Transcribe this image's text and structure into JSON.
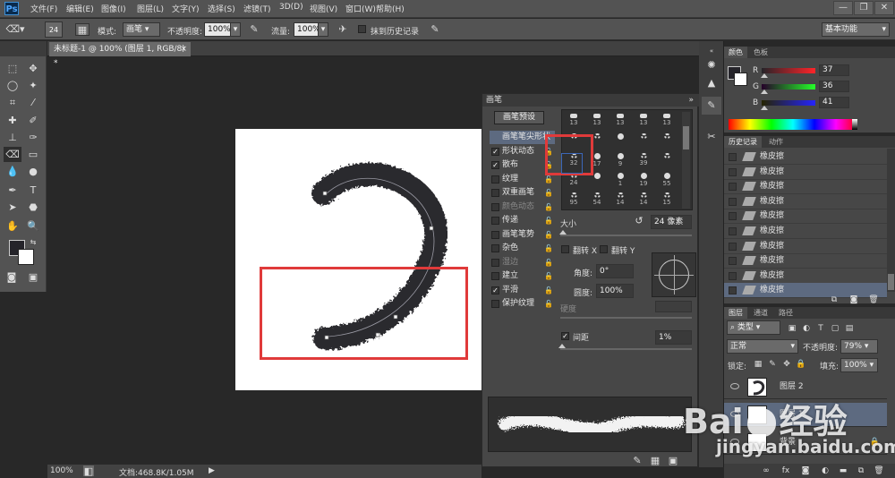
{
  "menubar": {
    "logo": "Ps",
    "items": [
      "文件(F)",
      "编辑(E)",
      "图像(I)",
      "图层(L)",
      "文字(Y)",
      "选择(S)",
      "滤镜(T)",
      "3D(D)",
      "视图(V)",
      "窗口(W)",
      "帮助(H)"
    ],
    "window_controls": [
      "—",
      "❐",
      "✕"
    ]
  },
  "options": {
    "brush_size": "24",
    "mode_label": "模式:",
    "mode_value": "画笔",
    "opacity_label": "不透明度:",
    "opacity_value": "100%",
    "flow_label": "流量:",
    "flow_value": "100%",
    "erase_history_label": "抹到历史记录",
    "workspace": "基本功能"
  },
  "document": {
    "tab_title": "未标题-1 @ 100% (图层 1, RGB/8) *",
    "close": "×"
  },
  "status": {
    "zoom": "100%",
    "doc_info": "文档:468.8K/1.05M"
  },
  "brush_panel": {
    "title": "画笔",
    "preset_button": "画笔预设",
    "sections": [
      {
        "label": "画笔笔尖形状",
        "checkbox": false,
        "checked": false,
        "selected": true,
        "dim": false,
        "lock": false
      },
      {
        "label": "形状动态",
        "checkbox": true,
        "checked": true,
        "selected": false,
        "dim": false,
        "lock": true
      },
      {
        "label": "散布",
        "checkbox": true,
        "checked": true,
        "selected": false,
        "dim": false,
        "lock": true
      },
      {
        "label": "纹理",
        "checkbox": true,
        "checked": false,
        "selected": false,
        "dim": false,
        "lock": true
      },
      {
        "label": "双重画笔",
        "checkbox": true,
        "checked": false,
        "selected": false,
        "dim": false,
        "lock": true
      },
      {
        "label": "颜色动态",
        "checkbox": true,
        "checked": false,
        "selected": false,
        "dim": true,
        "lock": true
      },
      {
        "label": "传递",
        "checkbox": true,
        "checked": false,
        "selected": false,
        "dim": false,
        "lock": true
      },
      {
        "label": "画笔笔势",
        "checkbox": true,
        "checked": false,
        "selected": false,
        "dim": false,
        "lock": true
      },
      {
        "label": "杂色",
        "checkbox": true,
        "checked": false,
        "selected": false,
        "dim": false,
        "lock": true
      },
      {
        "label": "湿边",
        "checkbox": true,
        "checked": false,
        "selected": false,
        "dim": true,
        "lock": true
      },
      {
        "label": "建立",
        "checkbox": true,
        "checked": false,
        "selected": false,
        "dim": false,
        "lock": true
      },
      {
        "label": "平滑",
        "checkbox": true,
        "checked": true,
        "selected": false,
        "dim": false,
        "lock": true
      },
      {
        "label": "保护纹理",
        "checkbox": true,
        "checked": false,
        "selected": false,
        "dim": false,
        "lock": true
      }
    ],
    "tips": [
      {
        "n": "13",
        "s": "bar"
      },
      {
        "n": "13",
        "s": "bar"
      },
      {
        "n": "13",
        "s": "bar"
      },
      {
        "n": "13",
        "s": "bar"
      },
      {
        "n": "13",
        "s": "bar"
      },
      {
        "n": "",
        "s": "splat"
      },
      {
        "n": "",
        "s": "splat"
      },
      {
        "n": "",
        "s": "round"
      },
      {
        "n": "",
        "s": "splat"
      },
      {
        "n": "",
        "s": "splat"
      },
      {
        "n": "32",
        "s": "splat"
      },
      {
        "n": "17",
        "s": "round"
      },
      {
        "n": "9",
        "s": "round"
      },
      {
        "n": "39",
        "s": "splat"
      },
      {
        "n": "",
        "s": "splat"
      },
      {
        "n": "24",
        "s": "splat"
      },
      {
        "n": "",
        "s": "round"
      },
      {
        "n": "1",
        "s": "round"
      },
      {
        "n": "19",
        "s": "round"
      },
      {
        "n": "55",
        "s": "round"
      },
      {
        "n": "95",
        "s": "splat"
      },
      {
        "n": "54",
        "s": "splat"
      },
      {
        "n": "14",
        "s": "splat"
      },
      {
        "n": "14",
        "s": "splat"
      },
      {
        "n": "15",
        "s": "splat"
      }
    ],
    "size_label": "大小",
    "size_value": "24 像素",
    "flip_x": "翻转 X",
    "flip_y": "翻转 Y",
    "angle_label": "角度:",
    "angle_value": "0°",
    "roundness_label": "圆度:",
    "roundness_value": "100%",
    "hardness_label": "硬度",
    "spacing_label": "间距",
    "spacing_value": "1%"
  },
  "color_panel": {
    "tabs": [
      "颜色",
      "色板"
    ],
    "channels": [
      {
        "label": "R",
        "value": "37"
      },
      {
        "label": "G",
        "value": "36"
      },
      {
        "label": "B",
        "value": "41"
      }
    ]
  },
  "history_panel": {
    "tabs": [
      "历史记录",
      "动作"
    ],
    "rows": [
      {
        "label": "橡皮擦",
        "selected": false
      },
      {
        "label": "橡皮擦",
        "selected": false
      },
      {
        "label": "橡皮擦",
        "selected": false
      },
      {
        "label": "橡皮擦",
        "selected": false
      },
      {
        "label": "橡皮擦",
        "selected": false
      },
      {
        "label": "橡皮擦",
        "selected": false
      },
      {
        "label": "橡皮擦",
        "selected": false
      },
      {
        "label": "橡皮擦",
        "selected": false
      },
      {
        "label": "橡皮擦",
        "selected": false
      },
      {
        "label": "橡皮擦",
        "selected": true
      }
    ]
  },
  "layers_panel": {
    "tabs": [
      "图层",
      "通道",
      "路径"
    ],
    "filter_label": "类型",
    "blend_mode": "正常",
    "opacity_label": "不透明度:",
    "opacity_value": "79%",
    "lock_label": "锁定:",
    "fill_label": "填充:",
    "fill_value": "100%",
    "layers": [
      {
        "name": "图层 2",
        "selected": false,
        "thumb": "stroke",
        "locked": false
      },
      {
        "name": "图层 1",
        "selected": true,
        "thumb": "white",
        "locked": false
      },
      {
        "name": "背景",
        "selected": false,
        "thumb": "white",
        "locked": true
      }
    ]
  },
  "watermark": {
    "brand": "Bai",
    "suffix": "经验",
    "url": "jingyan.baidu.com"
  },
  "colors": {
    "highlight_red": "#e03a3a",
    "selection_blue": "#5d6a80",
    "stroke_dark": "#2b2a2e"
  }
}
